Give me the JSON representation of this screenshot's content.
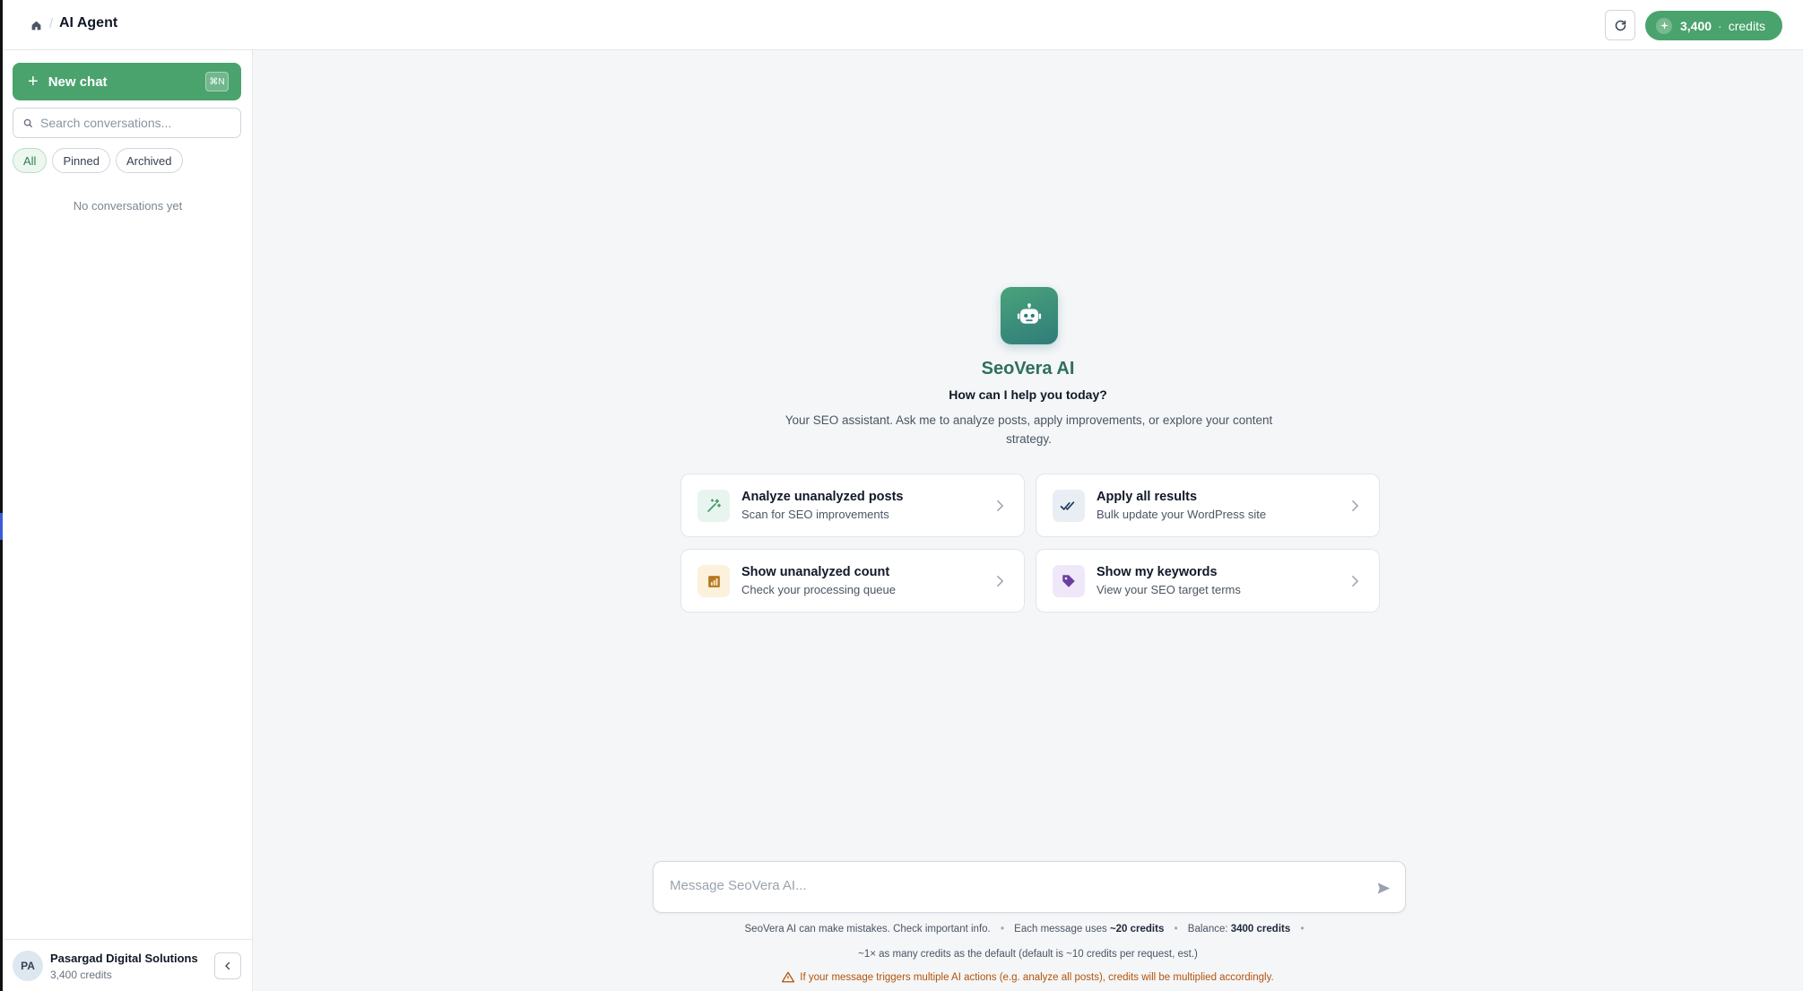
{
  "header": {
    "breadcrumb_title": "AI Agent",
    "breadcrumb_separator": "/",
    "credits_amount": "3,400",
    "credits_separator": "·",
    "credits_label": "credits",
    "accent_color": "#4aa36d"
  },
  "sidebar": {
    "new_chat_label": "New chat",
    "new_chat_shortcut": "⌘N",
    "search_placeholder": "Search conversations...",
    "filters": [
      {
        "label": "All",
        "active": true
      },
      {
        "label": "Pinned",
        "active": false
      },
      {
        "label": "Archived",
        "active": false
      }
    ],
    "empty_text": "No conversations yet",
    "footer": {
      "avatar_initials": "PA",
      "org_name": "Pasargad Digital Solutions",
      "org_credits": "3,400 credits"
    }
  },
  "main": {
    "brand_name": "SeoVera AI",
    "help_title": "How can I help you today?",
    "help_description": "Your SEO assistant. Ask me to analyze posts, apply improvements, or explore your content strategy.",
    "cards": [
      {
        "title": "Analyze unanalyzed posts",
        "subtitle": "Scan for SEO improvements",
        "icon": "magic-wand-icon",
        "icon_color": "#3f9a68",
        "icon_bg": "#e8f5ee"
      },
      {
        "title": "Apply all results",
        "subtitle": "Bulk update your WordPress site",
        "icon": "double-check-icon",
        "icon_color": "#1e3a5f",
        "icon_bg": "#e9eef4"
      },
      {
        "title": "Show unanalyzed count",
        "subtitle": "Check your processing queue",
        "icon": "bar-chart-icon",
        "icon_color": "#b7791f",
        "icon_bg": "#fbf1dd"
      },
      {
        "title": "Show my keywords",
        "subtitle": "View your SEO target terms",
        "icon": "tag-icon",
        "icon_color": "#6b3fa0",
        "icon_bg": "#efe8f8"
      }
    ],
    "composer_placeholder": "Message SeoVera AI...",
    "footnote": {
      "disclaimer": "SeoVera AI can make mistakes. Check important info.",
      "usage_prefix": "Each message uses ",
      "usage_value": "~20 credits",
      "balance_prefix": "Balance: ",
      "balance_value": "3400 credits",
      "multiplier_note": "~1× as many credits as the default (default is ~10 credits per request, est.)",
      "warning": "If your message triggers multiple AI actions (e.g. analyze all posts), credits will be multiplied accordingly."
    }
  }
}
